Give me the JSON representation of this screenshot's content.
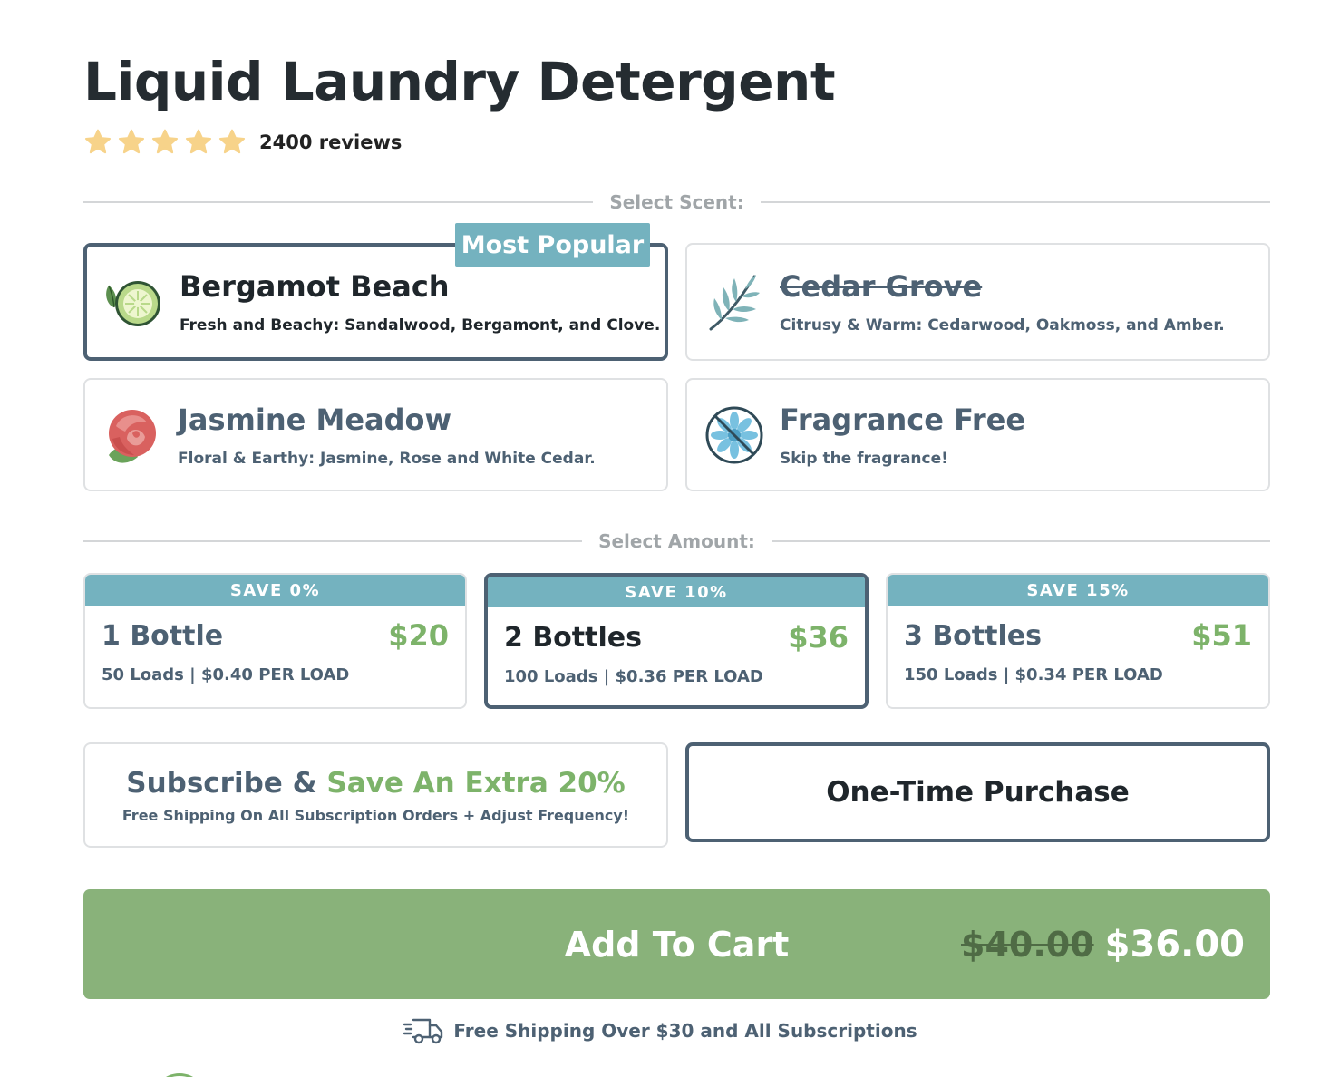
{
  "product": {
    "title": "Liquid Laundry Detergent",
    "rating": 5,
    "reviews_label": "2400 reviews"
  },
  "scent_section": {
    "label": "Select Scent:",
    "badge": "Most Popular",
    "options": [
      {
        "name": "Bergamot Beach",
        "desc": "Fresh and Beachy: Sandalwood, Bergamont, and Clove.",
        "icon": "citrus-slice-icon",
        "state": "selected"
      },
      {
        "name": "Cedar Grove",
        "desc": "Citrusy & Warm: Cedarwood, Oakmoss, and Amber.",
        "icon": "cedar-branch-icon",
        "state": "unavailable"
      },
      {
        "name": "Jasmine Meadow",
        "desc": "Floral & Earthy: Jasmine, Rose and White Cedar.",
        "icon": "rose-icon",
        "state": "default"
      },
      {
        "name": "Fragrance Free",
        "desc": "Skip the fragrance!",
        "icon": "no-fragrance-icon",
        "state": "default"
      }
    ]
  },
  "amount_section": {
    "label": "Select Amount:",
    "options": [
      {
        "save": "SAVE 0%",
        "qty": "1 Bottle",
        "price": "$20",
        "loads": "50 Loads | $0.40 PER LOAD",
        "selected": false
      },
      {
        "save": "SAVE 10%",
        "qty": "2 Bottles",
        "price": "$36",
        "loads": "100 Loads | $0.36 PER LOAD",
        "selected": true
      },
      {
        "save": "SAVE 15%",
        "qty": "3 Bottles",
        "price": "$51",
        "loads": "150 Loads | $0.34 PER LOAD",
        "selected": false
      }
    ]
  },
  "purchase": {
    "subscribe_prefix": "Subscribe & ",
    "subscribe_highlight": "Save An Extra 20%",
    "subscribe_note": "Free Shipping On All Subscription Orders + Adjust Frequency!",
    "one_time": "One-Time Purchase",
    "selected": "one-time"
  },
  "cart": {
    "label": "Add To Cart",
    "old_price": "$40.00",
    "new_price": "$36.00"
  },
  "shipping": {
    "icon": "delivery-truck-icon",
    "text": "Free Shipping Over $30 and All Subscriptions"
  },
  "colors": {
    "accent_teal": "#74b2bf",
    "accent_green": "#7db36a",
    "button_green": "#89b27a",
    "slate": "#4d6173",
    "star": "#f7d38a"
  }
}
